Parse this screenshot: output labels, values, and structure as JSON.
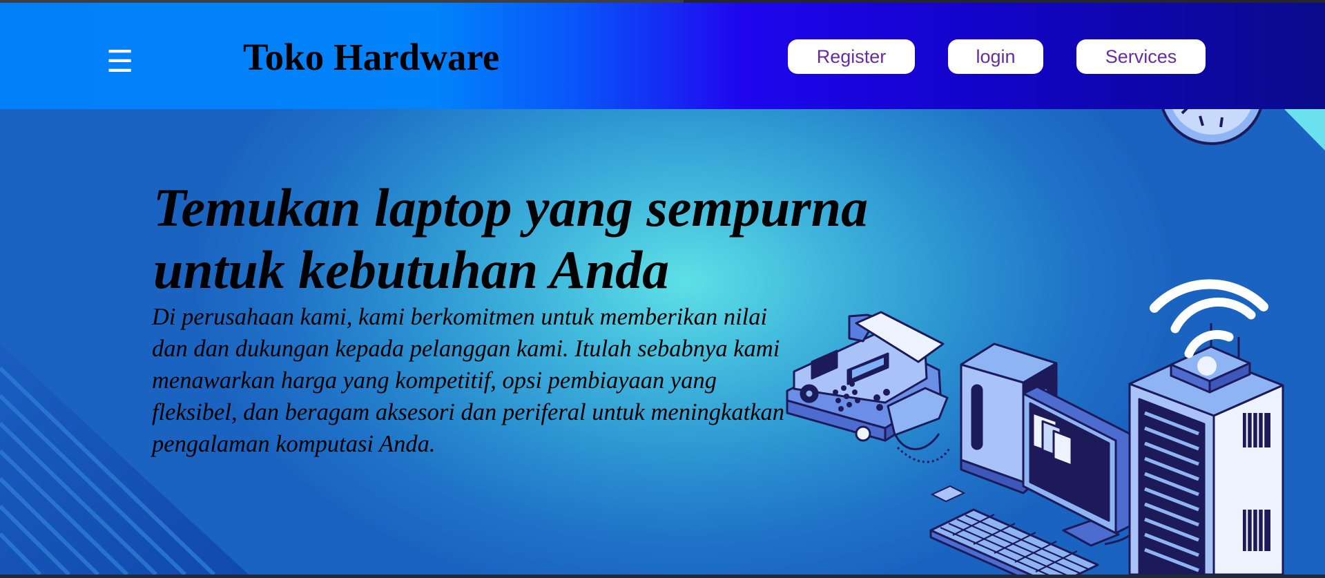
{
  "header": {
    "menu_icon": "hamburger-menu-icon",
    "brand": "Toko Hardware",
    "nav": [
      "Register",
      "login",
      "Services"
    ]
  },
  "hero": {
    "title": "Temukan laptop yang sempurna untuk kebutuhan Anda",
    "text": "Di perusahaan kami, kami berkomitmen untuk memberikan nilai dan dan dukungan kepada pelanggan kami. Itulah sebabnya kami menawarkan harga yang kompetitif, opsi pembiayaan yang fleksibel, dan beragam aksesori dan periferal untuk meningkatkan pengalaman komputasi Anda.",
    "illustration": [
      "fax-machine-icon",
      "tower-pc-icon",
      "monitor-icon",
      "keyboard-icon",
      "server-rack-icon",
      "wifi-router-icon",
      "wall-clock-icon"
    ]
  },
  "colors": {
    "header_blue": "#0180f9",
    "header_violet": "#1f06ee",
    "header_navy": "#0a0b8a",
    "hero_cyan": "#5ee0e6",
    "hero_blue": "#1a63c0",
    "button_text": "#6a2aa6"
  }
}
